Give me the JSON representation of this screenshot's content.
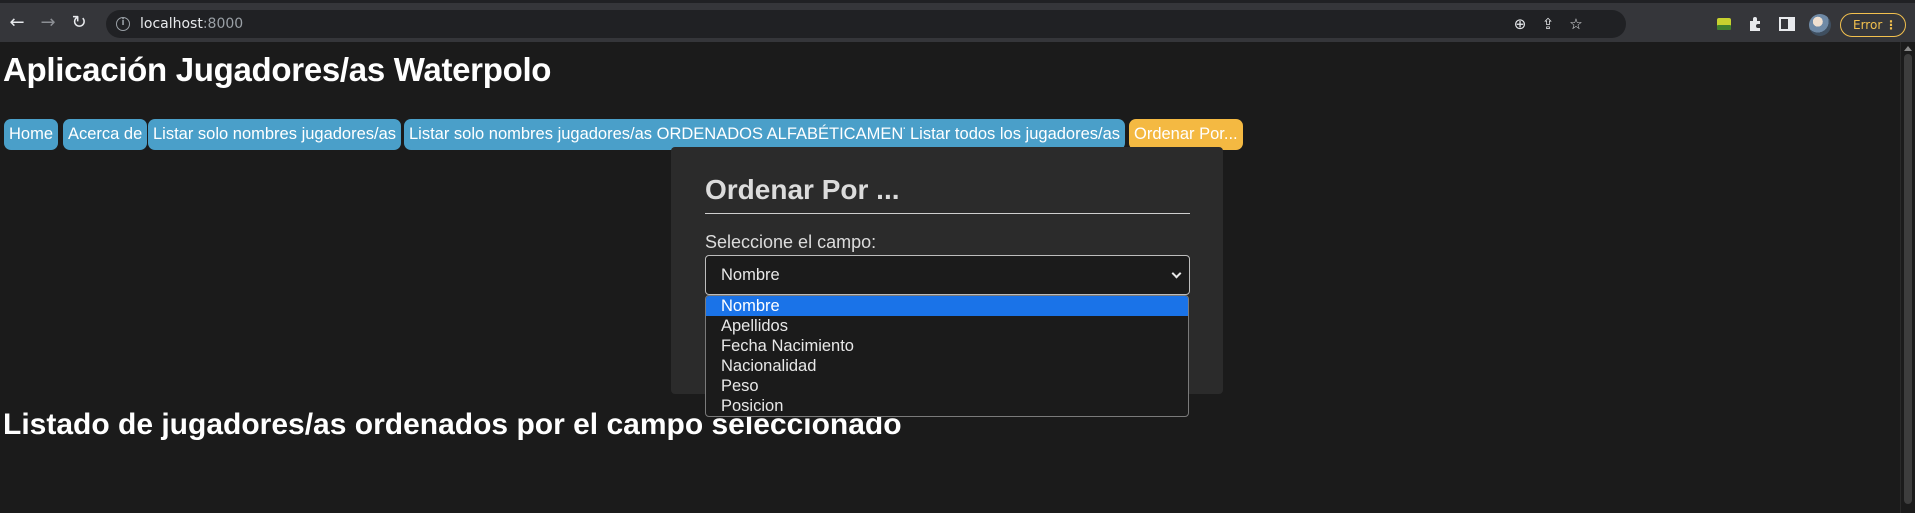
{
  "browser": {
    "url_host": "localhost",
    "url_port": ":8000",
    "error_label": "Error",
    "menu_glyph": "⋮",
    "back_glyph": "←",
    "forward_glyph": "→",
    "reload_glyph": "↻",
    "info_glyph": "i",
    "zoom_glyph": "⊕",
    "share_glyph": "⇪",
    "star_glyph": "☆"
  },
  "page": {
    "title": "Aplicación Jugadores/as Waterpolo",
    "nav": [
      {
        "label": "Home"
      },
      {
        "label": "Acerca de"
      },
      {
        "label": "Listar solo nombres jugadores/as"
      },
      {
        "label": "Listar solo nombres jugadores/as ORDENADOS ALFABÉTICAMENTE"
      },
      {
        "label": "Listar todos los jugadores/as"
      },
      {
        "label": "Ordenar Por..."
      }
    ],
    "card": {
      "title": "Ordenar Por ...",
      "field_label": "Seleccione el campo:",
      "selected_value": "Nombre",
      "options": [
        {
          "label": "Nombre"
        },
        {
          "label": "Apellidos"
        },
        {
          "label": "Fecha Nacimiento"
        },
        {
          "label": "Nacionalidad"
        },
        {
          "label": "Peso"
        },
        {
          "label": "Posicion"
        }
      ]
    },
    "partial_heading": "Listado de jugadores/as ordenados por el campo seleccionado"
  },
  "colors": {
    "nav_tab": "#4a9fc9",
    "nav_tab_active": "#f4b942",
    "selected_option": "#1a73e8",
    "error_accent": "#f2c04e"
  }
}
